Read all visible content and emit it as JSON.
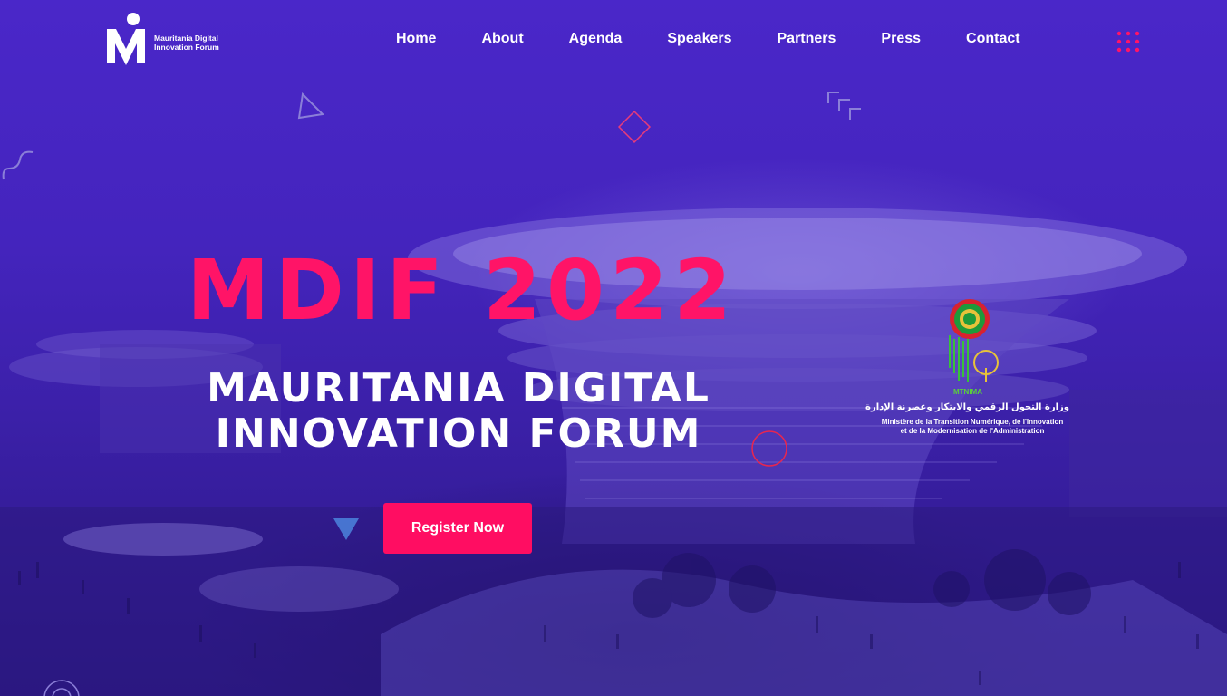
{
  "brand": {
    "logo_line1": "Mauritania Digital",
    "logo_line2": "Innovation Forum"
  },
  "nav": {
    "items": [
      {
        "label": "Home"
      },
      {
        "label": "About"
      },
      {
        "label": "Agenda"
      },
      {
        "label": "Speakers"
      },
      {
        "label": "Partners"
      },
      {
        "label": "Press"
      },
      {
        "label": "Contact"
      }
    ],
    "menu_icon": "grid-dots-icon"
  },
  "hero": {
    "title": "MDIF 2022",
    "subtitle_line1": "MAURITANIA DIGITAL",
    "subtitle_line2": "INNOVATION FORUM",
    "register_label": "Register Now"
  },
  "ministry": {
    "acronym": "MTNIMA",
    "arabic": "وزارة التحول الرقمي والابتكار وعصرنة الإدارة",
    "french_line1": "Ministère de la Transition Numérique, de l'Innovation",
    "french_line2": "et de la Modernisation de l'Administration"
  },
  "colors": {
    "background": "#4424bd",
    "accent": "#ff1467",
    "text": "#ffffff"
  }
}
